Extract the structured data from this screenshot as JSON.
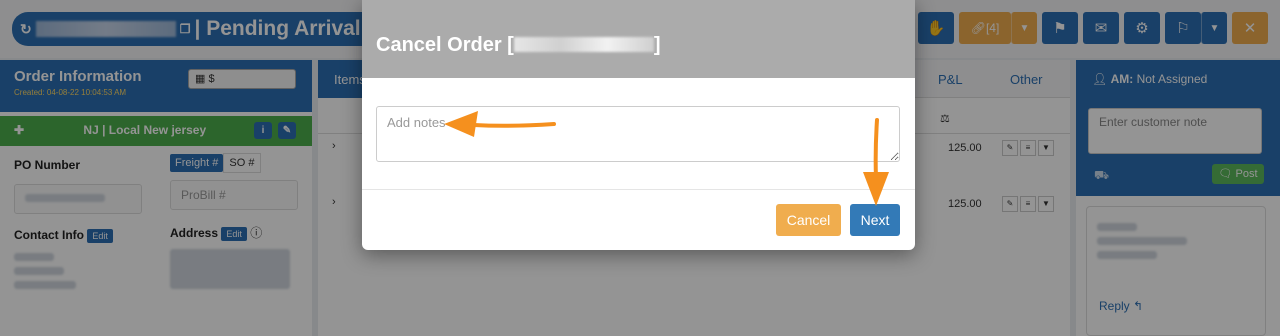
{
  "header": {
    "title_suffix": "| Pending Arrival",
    "link_count": "[4]"
  },
  "order_info": {
    "title": "Order Information",
    "created": "Created: 04-08-22 10:04:53 AM",
    "amount": "$"
  },
  "location": {
    "label": "NJ | Local New jersey"
  },
  "po": {
    "label": "PO Number",
    "freight_tab": "Freight #",
    "so_tab": "SO #",
    "probill_placeholder": "ProBill #"
  },
  "contact": {
    "label": "Contact Info",
    "edit": "Edit",
    "address_label": "Address",
    "address_edit": "Edit"
  },
  "tabs": {
    "items": "Items",
    "pl": "P&L",
    "other": "Other"
  },
  "rows": [
    {
      "amount": "125.00"
    },
    {
      "amount": "125.00"
    }
  ],
  "account_manager": {
    "label": "AM:",
    "value": "Not Assigned"
  },
  "customer_note": {
    "placeholder": "Enter customer note",
    "post": "Post",
    "reply": "Reply"
  },
  "modal": {
    "title": "Cancel Order [",
    "title_end": "]",
    "notes_placeholder": "Add notes",
    "cancel_label": "Cancel",
    "next_label": "Next"
  },
  "colors": {
    "primary": "#337ab7",
    "warning": "#f0ad4e",
    "success": "#5cb85c",
    "annotation_arrow": "#f5901e"
  },
  "icons": [
    "refresh-icon",
    "copy-icon",
    "hand-icon",
    "link-icon",
    "flag-icon",
    "envelope-icon",
    "gear-icon",
    "route-icon",
    "close-icon",
    "calculator-icon",
    "info-icon",
    "edit-icon",
    "user-icon",
    "phone-icon",
    "truck-icon",
    "reply-icon",
    "balance-icon"
  ]
}
